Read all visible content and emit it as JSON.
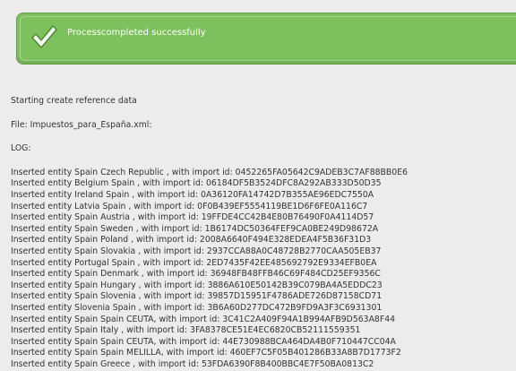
{
  "banner": {
    "message": "Processcompleted successfully",
    "icon": "check-icon",
    "color": "#7dc15c"
  },
  "content": {
    "heading": "Starting create reference data",
    "file_line": "File: Impuestos_para_España.xml:",
    "log_label": "LOG:",
    "log_lines": [
      "Inserted entity Spain Czech Republic , with import id: 0452265FA05642C9ADEB3C7AF88BB0E6",
      "Inserted entity Belgium  Spain , with import id: 06184DF5B3524DFC8A292AB333D50D35",
      "Inserted entity Ireland Spain , with import id: 0A36120FA14742D7B355AE96EDC7550A",
      "Inserted entity Latvia Spain , with import id: 0F0B439EF5554119BE1D6F6FE0A116C7",
      "Inserted entity Spain Austria , with import id: 19FFDE4CC42B4E80B76490F0A4114D57",
      "Inserted entity Spain Sweden , with import id: 1B6174DC50364FEF9CA0BE249D98672A",
      "Inserted entity Spain Poland , with import id: 2008A6640F494E328EDEA4F5B36F31D3",
      "Inserted entity Spain Slovakia , with import id: 2937CCA88A0C48728B2770CAA505EB37",
      "Inserted entity Portugal Spain , with import id: 2ED7435F42EE485692792E9334EFB0EA",
      "Inserted entity Spain Denmark , with import id: 36948FB48FFB46C69F484CD25EF9356C",
      "Inserted entity Spain Hungary , with import id: 3886A610E50142B39C079BA4A5EDDC23",
      "Inserted entity Spain Slovenia , with import id: 39857D15951F4786ADE726D87158CD71",
      "Inserted entity Slovenia Spain , with import id: 3B6A60D277DC472B9FD9A3F3C6931301",
      "Inserted entity Spain Spain CEUTA, with import id: 3C41C2A409F94A1B994AFB9D563A8F44",
      "Inserted entity Spain Italy , with import id: 3FA8378CE51E4EC6820CB52111559351",
      "Inserted entity Spain Spain CEUTA, with import id: 44E730988BCA464DA4B0F710447CC04A",
      "Inserted entity Spain Spain MELILLA, with import id: 460EF7C5F05B401286B33A8B7D1773F2",
      "Inserted entity Spain Greece , with import id: 53FDA6390F8B400BBC4E7F50BA0813C2"
    ]
  }
}
